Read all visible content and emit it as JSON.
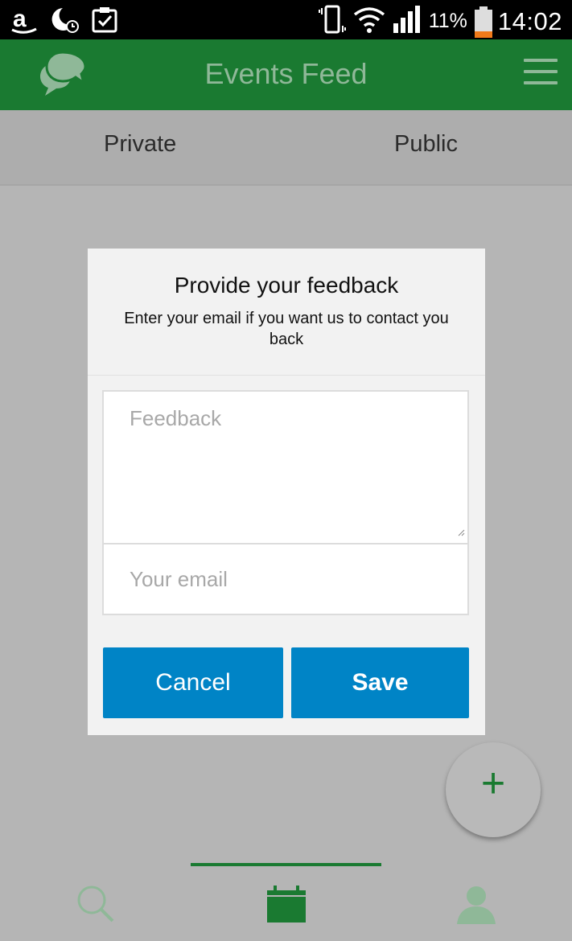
{
  "status_bar": {
    "battery_percent": "11%",
    "time": "14:02",
    "icons": [
      "amazon-icon",
      "sleep-timer-icon",
      "clipboard-check-icon",
      "vibrate-icon",
      "wifi-icon",
      "signal-icon",
      "battery-icon"
    ]
  },
  "app_bar": {
    "title": "Events Feed",
    "icons": [
      "chat-bubbles-icon",
      "menu-icon"
    ]
  },
  "tabs": [
    {
      "label": "Private"
    },
    {
      "label": "Public"
    }
  ],
  "dialog": {
    "title": "Provide your feedback",
    "subtitle": "Enter your email if you want us to contact you back",
    "feedback_placeholder": "Feedback",
    "email_placeholder": "Your email",
    "cancel_label": "Cancel",
    "save_label": "Save"
  },
  "fab": {
    "label": "+"
  },
  "bottom_nav": {
    "items": [
      "search-icon",
      "calendar-icon",
      "profile-icon"
    ],
    "selected": "calendar-icon"
  },
  "colors": {
    "brand_green": "#1a7a31",
    "button_blue": "#0084c6",
    "overlay_gray": "#b5b5b5"
  }
}
